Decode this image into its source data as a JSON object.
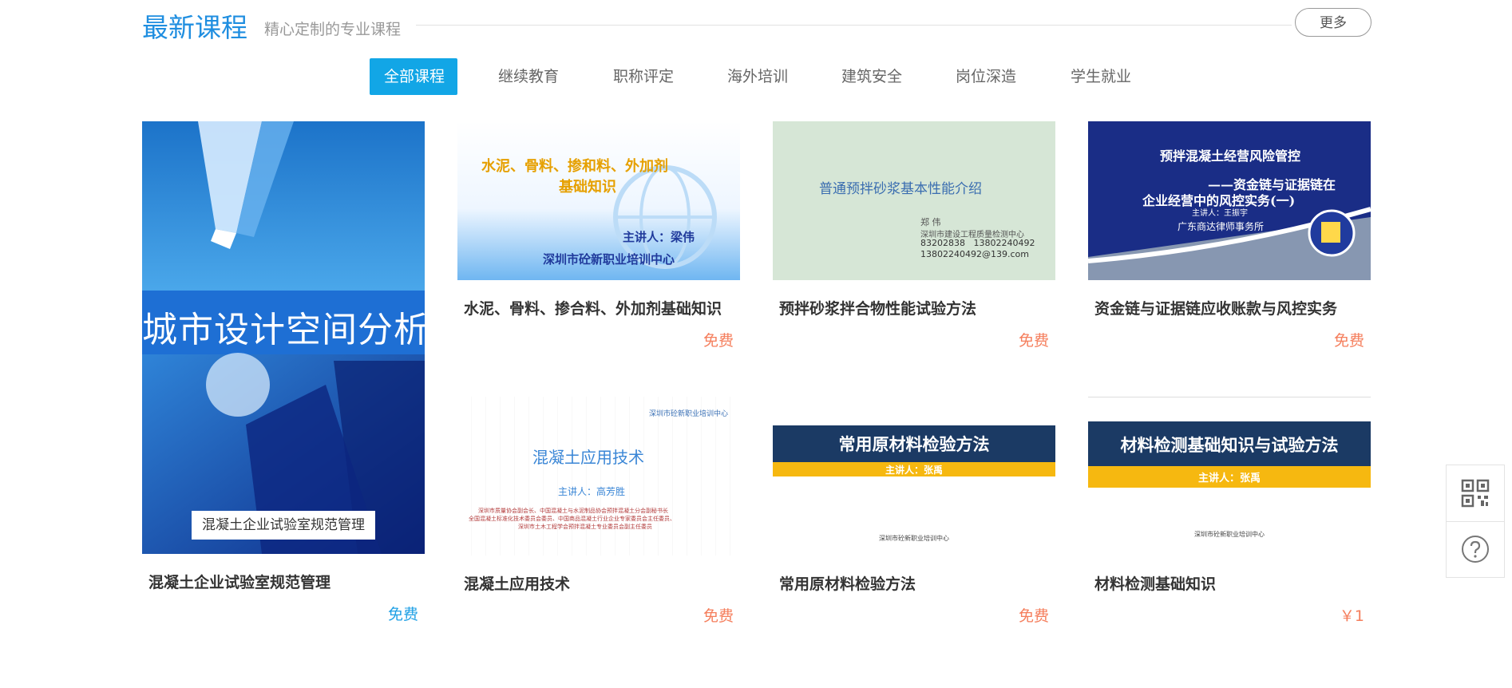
{
  "section": {
    "title": "最新课程",
    "subtitle": "精心定制的专业课程",
    "more_label": "更多"
  },
  "tabs": [
    {
      "label": "全部课程",
      "active": true
    },
    {
      "label": "继续教育",
      "active": false
    },
    {
      "label": "职称评定",
      "active": false
    },
    {
      "label": "海外培训",
      "active": false
    },
    {
      "label": "建筑安全",
      "active": false
    },
    {
      "label": "岗位深造",
      "active": false
    },
    {
      "label": "学生就业",
      "active": false
    }
  ],
  "courses": [
    {
      "title": "混凝土企业试验室规范管理",
      "price": "免费",
      "thumb": {
        "banner": "城市设计空间分析",
        "caption": "混凝土企业试验室规范管理"
      }
    },
    {
      "title": "水泥、骨料、掺合料、外加剂基础知识",
      "price": "免费",
      "thumb": {
        "line1": "水泥、骨料、掺和料、外加剂",
        "line2": "基础知识",
        "speaker": "主讲人：梁伟",
        "org": "深圳市砼新职业培训中心"
      }
    },
    {
      "title": "预拌砂浆拌合物性能试验方法",
      "price": "免费",
      "thumb": {
        "heading": "普通预拌砂浆基本性能介绍",
        "name": "郑 伟",
        "org": "深圳市建设工程质量检测中心",
        "phone": "83202838   13802240492",
        "email": "13802240492@139.com"
      }
    },
    {
      "title": "资金链与证据链应收账款与风控实务",
      "price": "免费",
      "thumb": {
        "line1": "预拌混凝土经营风险管控",
        "line2": "——资金链与证据链在",
        "line3": "企业经营中的风控实务(一)",
        "speaker": "主讲人：王振宇",
        "org": "广东商达律师事务所"
      }
    },
    {
      "title": "混凝土应用技术",
      "price": "免费",
      "thumb": {
        "org_top": "深圳市砼新职业培训中心",
        "heading": "混凝土应用技术",
        "speaker": "主讲人：高芳胜",
        "bio1": "深圳市质量协会副会长、中国混凝土与水泥制品协会预拌混凝土分会副秘书长",
        "bio2": "全国混凝土标准化技术委员会委员、中国商品混凝土行业企业专家委员会主任委员、",
        "bio3": "深圳市土木工程学会预拌混凝土专业委员会副主任委员"
      }
    },
    {
      "title": "常用原材料检验方法",
      "price": "免费",
      "thumb": {
        "heading": "常用原材料检验方法",
        "speaker": "主讲人：张禹",
        "org": "深圳市砼新职业培训中心"
      }
    },
    {
      "title": "材料检测基础知识",
      "price": "￥1",
      "thumb": {
        "heading": "材料检测基础知识与试验方法",
        "speaker": "主讲人：张禹",
        "org": "深圳市砼新职业培训中心"
      }
    }
  ],
  "side_tools": {
    "qr_icon": "qr-code-icon",
    "help_icon": "question-icon"
  },
  "colors": {
    "accent": "#12a6e6",
    "title": "#1f8ee0",
    "price": "#f57e5c",
    "price_first": "#1fa0e5"
  }
}
